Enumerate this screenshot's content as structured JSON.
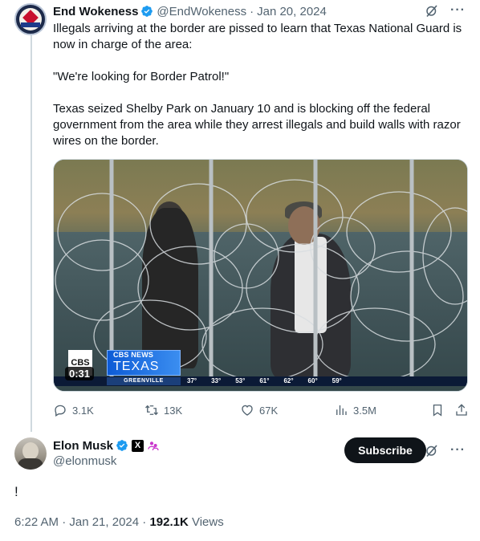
{
  "tweet": {
    "author_name": "End Wokeness",
    "author_handle": "@EndWokeness",
    "date": "Jan 20, 2024",
    "text": "Illegals arriving at the border are pissed to learn that Texas National Guard is now in charge of the area:\n\n\"We're looking for Border Patrol!\"\n\nTexas seized Shelby Park on January 10 and is blocking off the federal government from the area while they arrest illegals and build walls with razor wires on the border.",
    "video": {
      "duration": "0:31",
      "network_logo": "CBS",
      "network_name": "CBS NEWS",
      "station": "TEXAS",
      "location": "GREENVILLE",
      "forecast": [
        "37°",
        "33°",
        "53°",
        "61°",
        "62°",
        "60°",
        "59°"
      ]
    },
    "stats": {
      "replies": "3.1K",
      "reposts": "13K",
      "likes": "67K",
      "views": "3.5M"
    }
  },
  "reply": {
    "author_name": "Elon Musk",
    "author_handle": "@elonmusk",
    "x_badge": "X",
    "subscribe_label": "Subscribe",
    "text": "!",
    "time": "6:22 AM · Jan 21, 2024 · ",
    "views_count": "192.1K",
    "views_label": " Views"
  },
  "icons": [
    "verified-icon",
    "grok-icon",
    "more-icon",
    "reply-icon",
    "repost-icon",
    "like-icon",
    "views-icon",
    "bookmark-icon",
    "share-icon"
  ],
  "colors": {
    "verified": "#1d9bf0",
    "muted": "#536471",
    "subscribe_bg": "#0f1419",
    "affiliate": "#c936cc"
  }
}
